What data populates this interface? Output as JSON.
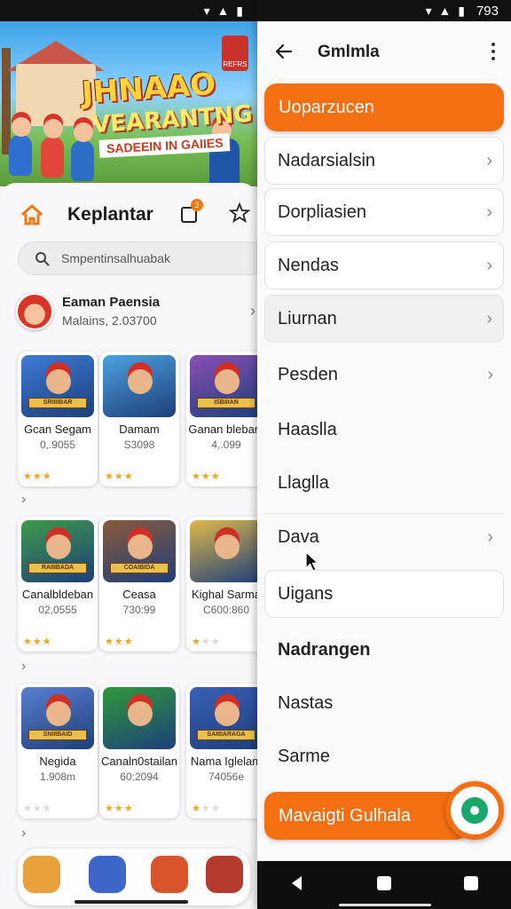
{
  "left": {
    "banner": {
      "title_line1": "JHNAAO",
      "title_line2": "VEARANTNG",
      "subtitle": "SADEEIN IN GAIIES",
      "badge": "REFRS"
    },
    "toolbar": {
      "title": "Keplantar",
      "cart_count": "3"
    },
    "search": {
      "placeholder": "Smpentinsalhuabak"
    },
    "profile": {
      "name": "Eaman Paensia",
      "sub": "Malains, 2.03700"
    },
    "cards": [
      {
        "title": "Gcan Segam",
        "meta": "0,.9055",
        "stars": 3,
        "ribbon": "SRIIIIBAR",
        "color": "#3d7bd6"
      },
      {
        "title": "Damam",
        "meta": "S3098",
        "stars": 3,
        "ribbon": "",
        "color": "#4aa3e0"
      },
      {
        "title": "Ganan blebam",
        "meta": "4,.099",
        "stars": 3,
        "ribbon": "ISBIIIAN",
        "color": "#8a4fb5"
      },
      {
        "title": "Canalbldeban",
        "meta": "02,0555",
        "stars": 3,
        "ribbon": "RAIIIBADA",
        "color": "#3f9b4a"
      },
      {
        "title": "Ceasa",
        "meta": "730:99",
        "stars": 3,
        "ribbon": "COAIBIDA",
        "color": "#8b5a3a"
      },
      {
        "title": "Kighal Sarma",
        "meta": "C600:860",
        "stars": 1,
        "ribbon": "",
        "color": "#e0b84a"
      },
      {
        "title": "Negida",
        "meta": "1.908m",
        "stars": 0,
        "ribbon": "SNIIIBAID",
        "color": "#5a7fd0"
      },
      {
        "title": "Canaln0stailan",
        "meta": "60:2094",
        "stars": 3,
        "ribbon": "",
        "color": "#2f9a3a"
      },
      {
        "title": "Nama Iglelam",
        "meta": "74056e",
        "stars": 1,
        "ribbon": "SAIIIIARAGA",
        "color": "#3b5fb8"
      }
    ]
  },
  "right": {
    "status": {
      "time": "793"
    },
    "title": "Gmlmla",
    "top_button": "Uoparzucen",
    "items": [
      {
        "label": "Nadarsialsin",
        "chevron": true,
        "style": "card"
      },
      {
        "label": "Dorpliasien",
        "chevron": true,
        "style": "card"
      },
      {
        "label": "Nendas",
        "chevron": true,
        "style": "card"
      },
      {
        "label": "Liurnan",
        "chevron": true,
        "style": "shade"
      },
      {
        "label": "Pesden",
        "chevron": true,
        "style": "plain"
      },
      {
        "label": "Haaslla",
        "chevron": false,
        "style": "plain"
      },
      {
        "label": "Llaglla",
        "chevron": false,
        "style": "plain"
      },
      {
        "label": "Dava",
        "chevron": true,
        "style": "sep"
      },
      {
        "label": "Uigans",
        "chevron": false,
        "style": "card"
      },
      {
        "label": "Nadrangen",
        "chevron": false,
        "style": "bold"
      },
      {
        "label": "Nastas",
        "chevron": false,
        "style": "plain"
      },
      {
        "label": "Sarme",
        "chevron": false,
        "style": "plain"
      }
    ],
    "bottom_button": "Mavaigti Gulhala"
  },
  "colors": {
    "accent": "#f36f12",
    "fab": "#19a86b"
  }
}
